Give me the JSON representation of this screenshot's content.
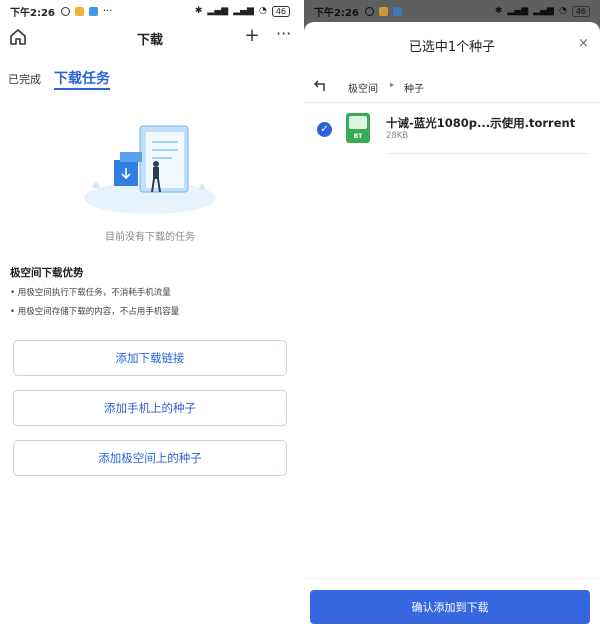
{
  "status_bar": {
    "time": "下午2:26",
    "battery": "46"
  },
  "left": {
    "header": {
      "title": "下载",
      "plus_icon": "+",
      "more_icon": "···"
    },
    "tabs": {
      "completed": "已完成",
      "tasks": "下载任务"
    },
    "empty_state": {
      "text": "目前没有下载的任务"
    },
    "advantages": {
      "title": "极空间下载优势",
      "items": [
        "• 用极空间执行下载任务，不消耗手机流量",
        "• 用极空间存储下载的内容，不占用手机容量"
      ]
    },
    "buttons": {
      "add_link": "添加下载链接",
      "add_phone_torrent": "添加手机上的种子",
      "add_space_torrent": "添加极空间上的种子"
    },
    "colors": {
      "accent": "#2c63d6"
    }
  },
  "right": {
    "sheet": {
      "title": "已选中1个种子",
      "close_icon": "×"
    },
    "path": {
      "root": "极空间",
      "separator": "▸",
      "current": "种子"
    },
    "file": {
      "name": "十诫-蓝光1080p...示使用.torrent",
      "size": "28KB",
      "icon_label": "BT",
      "checked_icon": "✓"
    },
    "confirm_button": "确认添加到下载",
    "colors": {
      "button": "#3666e0"
    }
  }
}
